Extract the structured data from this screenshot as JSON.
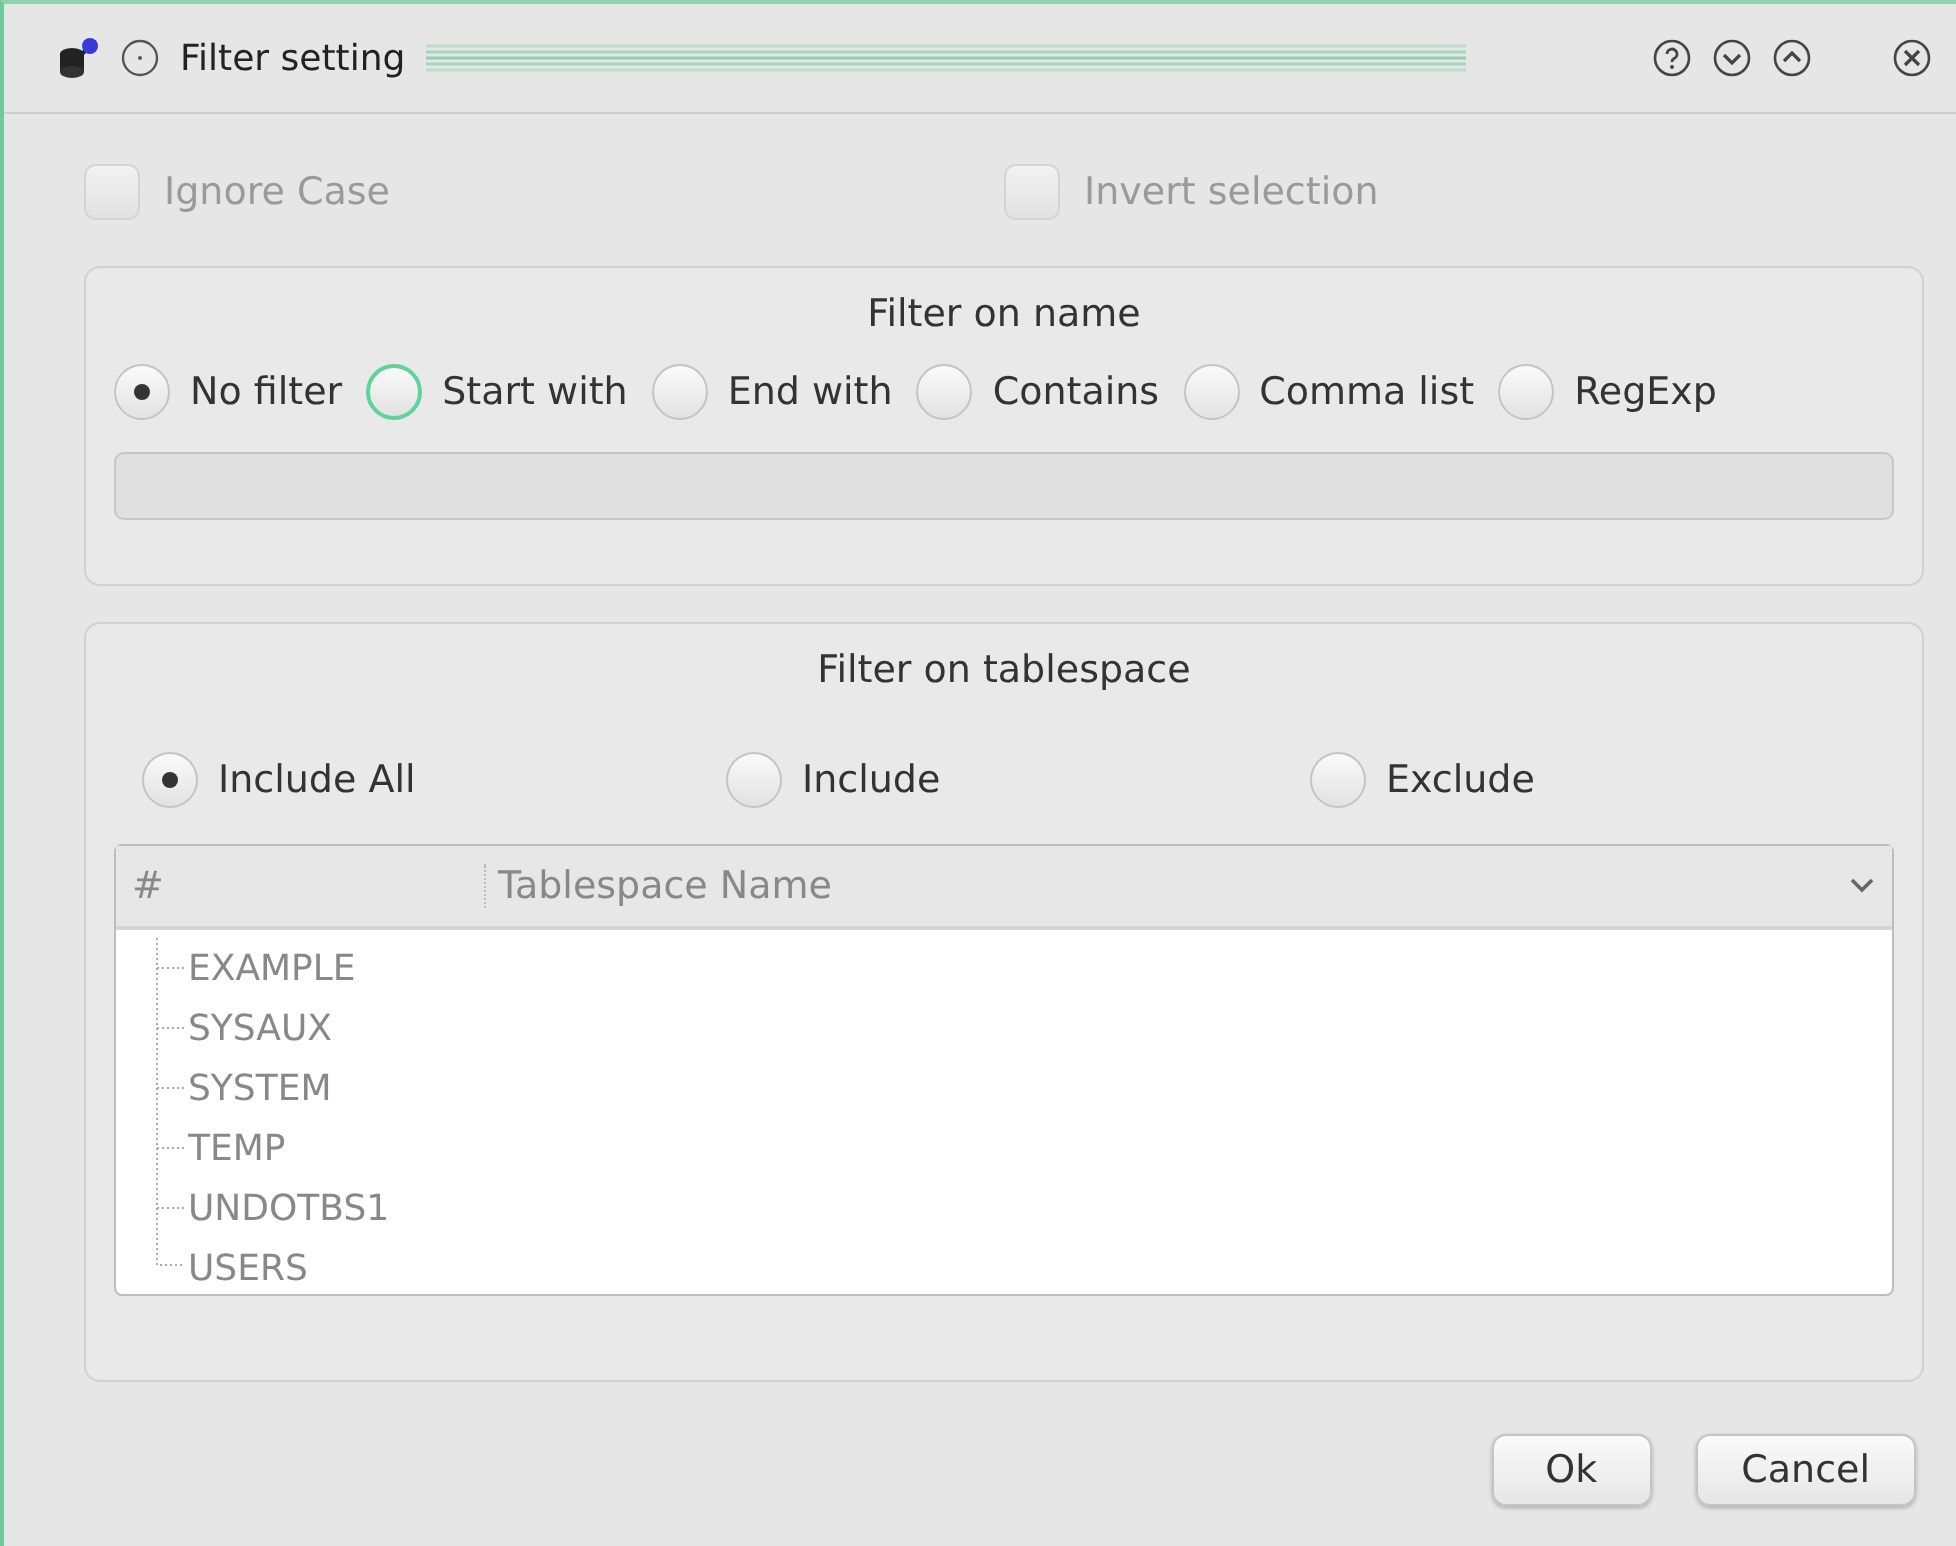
{
  "window": {
    "title": "Filter setting"
  },
  "options": [
    {
      "label": "Ignore Case",
      "checked": false,
      "disabled": true
    },
    {
      "label": "Invert selection",
      "checked": false,
      "disabled": true
    }
  ],
  "name_filter": {
    "title": "Filter on name",
    "modes": [
      {
        "label": "No filter",
        "selected": true,
        "focused": false
      },
      {
        "label": "Start with",
        "selected": false,
        "focused": true
      },
      {
        "label": "End with",
        "selected": false,
        "focused": false
      },
      {
        "label": "Contains",
        "selected": false,
        "focused": false
      },
      {
        "label": "Comma list",
        "selected": false,
        "focused": false
      },
      {
        "label": "RegExp",
        "selected": false,
        "focused": false
      }
    ],
    "pattern_disabled": true
  },
  "tablespace_filter": {
    "title": "Filter on tablespace",
    "modes": [
      {
        "label": "Include All",
        "selected": true
      },
      {
        "label": "Include",
        "selected": false
      },
      {
        "label": "Exclude",
        "selected": false
      }
    ],
    "table": {
      "columns": [
        "#",
        "Tablespace Name"
      ],
      "rows": [
        {
          "name": "EXAMPLE"
        },
        {
          "name": "SYSAUX"
        },
        {
          "name": "SYSTEM"
        },
        {
          "name": "TEMP"
        },
        {
          "name": "UNDOTBS1"
        },
        {
          "name": "USERS"
        }
      ]
    }
  },
  "buttons": [
    "Ok",
    "Cancel"
  ]
}
